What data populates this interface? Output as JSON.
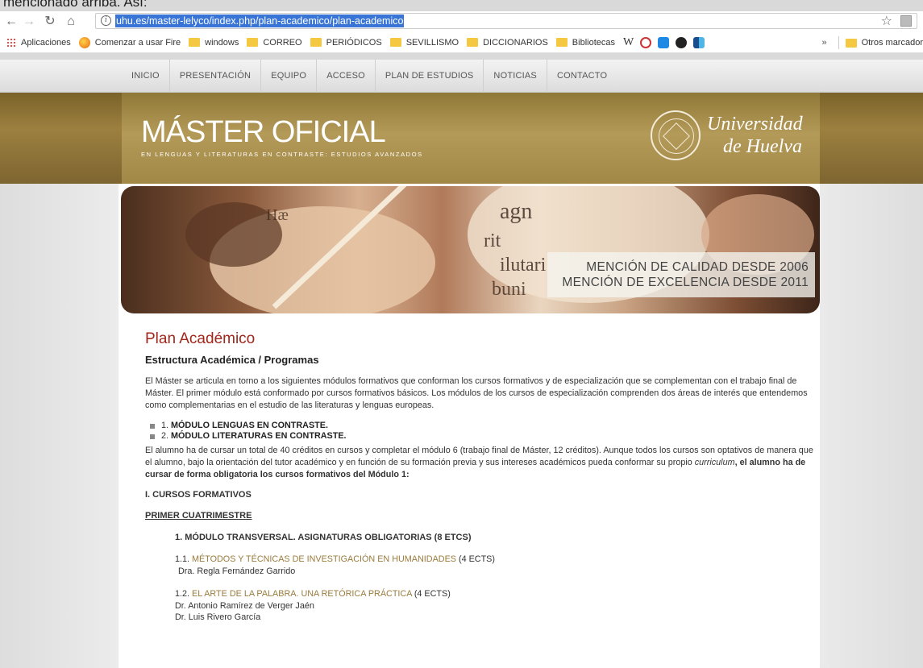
{
  "top_text": "mencionado arriba. Así:",
  "browser": {
    "url": "uhu.es/master-lelyco/index.php/plan-academico/plan-academico",
    "bookmarks": [
      "Aplicaciones",
      "Comenzar a usar Fire",
      "windows",
      "CORREO",
      "PERIÓDICOS",
      "SEVILLISMO",
      "DICCIONARIOS",
      "Bibliotecas"
    ],
    "bookmarks_more": "»",
    "other_bookmarks": "Otros marcador"
  },
  "site_nav": [
    "INICIO",
    "PRESENTACIÓN",
    "EQUIPO",
    "ACCESO",
    "PLAN DE ESTUDIOS",
    "NOTICIAS",
    "CONTACTO"
  ],
  "banner": {
    "title": "MÁSTER OFICIAL",
    "subtitle": "EN LENGUAS Y LITERATURAS EN CONTRASTE: ESTUDIOS AVANZADOS",
    "university_line1": "Universidad",
    "university_line2": "de Huelva"
  },
  "hero": {
    "line1": "MENCIÓN DE CALIDAD DESDE 2006",
    "line2": "MENCIÓN DE EXCELENCIA DESDE 2011"
  },
  "article": {
    "title": "Plan Académico",
    "subtitle": "Estructura Académica / Programas",
    "intro": "El Máster se articula en torno a los siguientes módulos formativos que conforman los cursos formativos y de especialización que se complementan con el trabajo final de Máster. El primer módulo está conformado por cursos formativos básicos. Los módulos de los cursos de especialización comprenden dos áreas de interés que entendemos como complementarias en el estudio de las literaturas y lenguas europeas.",
    "bullets": [
      {
        "num": "1.",
        "text": "MÓDULO LENGUAS EN CONTRASTE."
      },
      {
        "num": "2.",
        "text": "MÓDULO LITERATURAS EN CONTRASTE."
      }
    ],
    "para2_a": "El alumno ha de cursar un total de 40 créditos en cursos y completar el módulo 6 (trabajo final de Máster, 12 créditos). Aunque todos los cursos son optativos de manera que el alumno, bajo la orientación del tutor académico y en función de su formación previa y sus intereses académicos pueda conformar su propio ",
    "para2_em": "curriculum",
    "para2_b": ", el alumno ha de cursar de forma obligatoria los cursos formativos del Módulo 1:",
    "section": "I. CURSOS FORMATIVOS",
    "semester": "PRIMER CUATRIMESTRE",
    "module": "1. MÓDULO TRANSVERSAL. ASIGNATURAS OBLIGATORIAS (8 ETCS)",
    "courses": [
      {
        "num": "1.1.",
        "name": "MÉTODOS Y TÉCNICAS DE INVESTIGACIÓN EN HUMANIDADES",
        "credits": "(4 ECTS)",
        "teachers": [
          "Dra. Regla Fernández Garrido"
        ]
      },
      {
        "num": "1.2.",
        "name": "EL ARTE DE LA PALABRA. UNA RETÓRICA PRÁCTICA",
        "credits": "(4 ECTS)",
        "teachers": [
          "Dr. Antonio Ramírez de Verger Jaén",
          "Dr. Luis Rivero García"
        ]
      }
    ]
  }
}
